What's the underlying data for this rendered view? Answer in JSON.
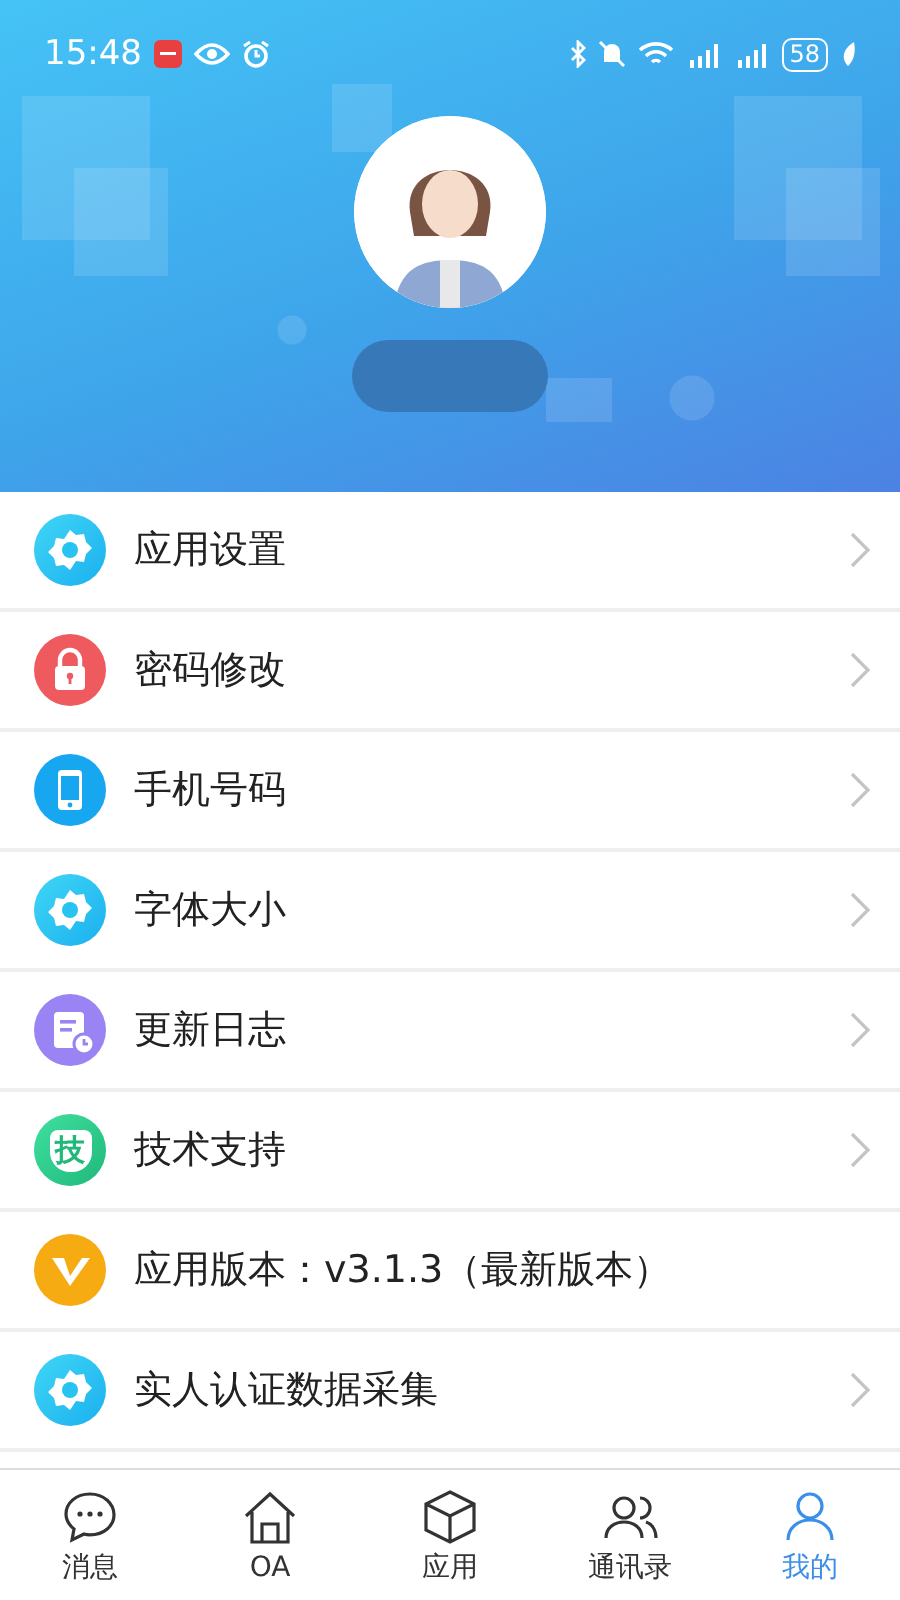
{
  "status_bar": {
    "time": "15:48",
    "battery": "58"
  },
  "menu": [
    {
      "label": "应用设置",
      "kind": "gear",
      "arrow": true
    },
    {
      "label": "密码修改",
      "kind": "lock",
      "arrow": true
    },
    {
      "label": "手机号码",
      "kind": "phone",
      "arrow": true
    },
    {
      "label": "字体大小",
      "kind": "gear",
      "arrow": true
    },
    {
      "label": "更新日志",
      "kind": "log",
      "arrow": true
    },
    {
      "label": "技术支持",
      "kind": "text",
      "icon_text": "技",
      "arrow": true
    },
    {
      "label": "应用版本：v3.1.3（最新版本）",
      "kind": "version",
      "arrow": false
    },
    {
      "label": "实人认证数据采集",
      "kind": "gear",
      "arrow": true
    }
  ],
  "tabs": [
    {
      "label": "消息",
      "kind": "chat",
      "selected": false
    },
    {
      "label": "OA",
      "kind": "home",
      "selected": false
    },
    {
      "label": "应用",
      "kind": "cube",
      "selected": false
    },
    {
      "label": "通讯录",
      "kind": "contacts",
      "selected": false
    },
    {
      "label": "我的",
      "kind": "person",
      "selected": true
    }
  ]
}
